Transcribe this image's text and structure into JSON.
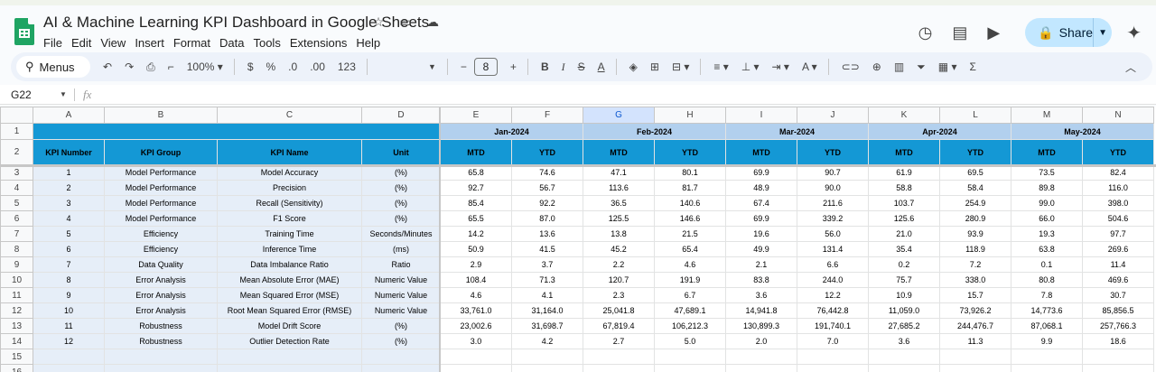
{
  "app": {
    "doc_title": "AI & Machine Learning KPI Dashboard in Google Sheets",
    "menu": [
      "File",
      "Edit",
      "View",
      "Insert",
      "Format",
      "Data",
      "Tools",
      "Extensions",
      "Help"
    ],
    "share_label": "Share"
  },
  "toolbar": {
    "menus_label": "Menus",
    "zoom": "100%",
    "currency": "$",
    "percent": "%",
    "decrease_decimal": ".0",
    "increase_decimal": ".00",
    "number_format": "123",
    "font_size": "8",
    "bold": "B",
    "text_color": "A"
  },
  "formula_bar": {
    "cell_ref": "G22",
    "fx": "fx"
  },
  "columns": [
    "A",
    "B",
    "C",
    "D",
    "E",
    "F",
    "G",
    "H",
    "I",
    "J",
    "K",
    "L",
    "M",
    "N"
  ],
  "selected_column": "G",
  "rows": [
    "1",
    "2",
    "3",
    "4",
    "5",
    "6",
    "7",
    "8",
    "9",
    "10",
    "11",
    "12",
    "13",
    "14",
    "15",
    "16"
  ],
  "months": [
    "Jan-2024",
    "Feb-2024",
    "Mar-2024",
    "Apr-2024",
    "May-2024"
  ],
  "headers": {
    "kpi_number": "KPI Number",
    "kpi_group": "KPI Group",
    "kpi_name": "KPI Name",
    "unit": "Unit",
    "mtd": "MTD",
    "ytd": "YTD"
  },
  "kpis": [
    {
      "num": "1",
      "group": "Model Performance",
      "name": "Model Accuracy",
      "unit": "(%)",
      "vals": [
        "65.8",
        "74.6",
        "47.1",
        "80.1",
        "69.9",
        "90.7",
        "61.9",
        "69.5",
        "73.5",
        "82.4"
      ]
    },
    {
      "num": "2",
      "group": "Model Performance",
      "name": "Precision",
      "unit": "(%)",
      "vals": [
        "92.7",
        "56.7",
        "113.6",
        "81.7",
        "48.9",
        "90.0",
        "58.8",
        "58.4",
        "89.8",
        "116.0"
      ]
    },
    {
      "num": "3",
      "group": "Model Performance",
      "name": "Recall (Sensitivity)",
      "unit": "(%)",
      "vals": [
        "85.4",
        "92.2",
        "36.5",
        "140.6",
        "67.4",
        "211.6",
        "103.7",
        "254.9",
        "99.0",
        "398.0"
      ]
    },
    {
      "num": "4",
      "group": "Model Performance",
      "name": "F1 Score",
      "unit": "(%)",
      "vals": [
        "65.5",
        "87.0",
        "125.5",
        "146.6",
        "69.9",
        "339.2",
        "125.6",
        "280.9",
        "66.0",
        "504.6"
      ]
    },
    {
      "num": "5",
      "group": "Efficiency",
      "name": "Training Time",
      "unit": "Seconds/Minutes",
      "vals": [
        "14.2",
        "13.6",
        "13.8",
        "21.5",
        "19.6",
        "56.0",
        "21.0",
        "93.9",
        "19.3",
        "97.7"
      ]
    },
    {
      "num": "6",
      "group": "Efficiency",
      "name": "Inference Time",
      "unit": "(ms)",
      "vals": [
        "50.9",
        "41.5",
        "45.2",
        "65.4",
        "49.9",
        "131.4",
        "35.4",
        "118.9",
        "63.8",
        "269.6"
      ]
    },
    {
      "num": "7",
      "group": "Data Quality",
      "name": "Data Imbalance Ratio",
      "unit": "Ratio",
      "vals": [
        "2.9",
        "3.7",
        "2.2",
        "4.6",
        "2.1",
        "6.6",
        "0.2",
        "7.2",
        "0.1",
        "11.4"
      ]
    },
    {
      "num": "8",
      "group": "Error Analysis",
      "name": "Mean Absolute Error (MAE)",
      "unit": "Numeric Value",
      "vals": [
        "108.4",
        "71.3",
        "120.7",
        "191.9",
        "83.8",
        "244.0",
        "75.7",
        "338.0",
        "80.8",
        "469.6"
      ]
    },
    {
      "num": "9",
      "group": "Error Analysis",
      "name": "Mean Squared Error (MSE)",
      "unit": "Numeric Value",
      "vals": [
        "4.6",
        "4.1",
        "2.3",
        "6.7",
        "3.6",
        "12.2",
        "10.9",
        "15.7",
        "7.8",
        "30.7"
      ]
    },
    {
      "num": "10",
      "group": "Error Analysis",
      "name": "Root Mean Squared Error (RMSE)",
      "unit": "Numeric Value",
      "vals": [
        "33,761.0",
        "31,164.0",
        "25,041.8",
        "47,689.1",
        "14,941.8",
        "76,442.8",
        "11,059.0",
        "73,926.2",
        "14,773.6",
        "85,856.5"
      ]
    },
    {
      "num": "11",
      "group": "Robustness",
      "name": "Model Drift Score",
      "unit": "(%)",
      "vals": [
        "23,002.6",
        "31,698.7",
        "67,819.4",
        "106,212.3",
        "130,899.3",
        "191,740.1",
        "27,685.2",
        "244,476.7",
        "87,068.1",
        "257,766.3"
      ]
    },
    {
      "num": "12",
      "group": "Robustness",
      "name": "Outlier Detection Rate",
      "unit": "(%)",
      "vals": [
        "3.0",
        "4.2",
        "2.7",
        "5.0",
        "2.0",
        "7.0",
        "3.6",
        "11.3",
        "9.9",
        "18.6"
      ]
    }
  ]
}
